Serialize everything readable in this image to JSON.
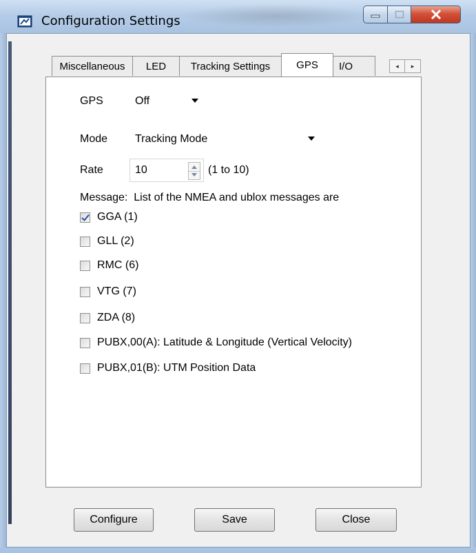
{
  "window": {
    "title": "Configuration Settings",
    "icon": "app-window-icon",
    "controls": {
      "minimize": "minimize-icon",
      "maximize": "maximize-icon",
      "close": "close-icon"
    }
  },
  "tabs": [
    {
      "label": "Miscellaneous",
      "selected": false
    },
    {
      "label": "LED",
      "selected": false
    },
    {
      "label": "Tracking Settings",
      "selected": false
    },
    {
      "label": "GPS",
      "selected": true
    },
    {
      "label": "I/O",
      "selected": false
    }
  ],
  "tab_scroll": {
    "left": "◂",
    "right": "▸"
  },
  "gps": {
    "gps_label": "GPS",
    "gps_value": "Off",
    "mode_label": "Mode",
    "mode_value": "Tracking Mode",
    "rate_label": "Rate",
    "rate_value": "10",
    "rate_hint": "(1 to 10)",
    "message_label": "Message:  List of the NMEA and ublox messages are",
    "messages": [
      {
        "label": "GGA (1)",
        "checked": true
      },
      {
        "label": "GLL (2)",
        "checked": false
      },
      {
        "label": "RMC (6)",
        "checked": false
      },
      {
        "label": "VTG (7)",
        "checked": false
      },
      {
        "label": "ZDA (8)",
        "checked": false
      },
      {
        "label": "PUBX,00(A): Latitude & Longitude (Vertical Velocity)",
        "checked": false
      },
      {
        "label": "PUBX,01(B): UTM Position Data",
        "checked": false
      }
    ]
  },
  "buttons": {
    "configure": "Configure",
    "save": "Save",
    "close": "Close"
  },
  "colors": {
    "titlebar": "#b5cde8",
    "close_button": "#c2361f",
    "client_background": "#f0f0f0",
    "panel_background": "#ffffff"
  }
}
